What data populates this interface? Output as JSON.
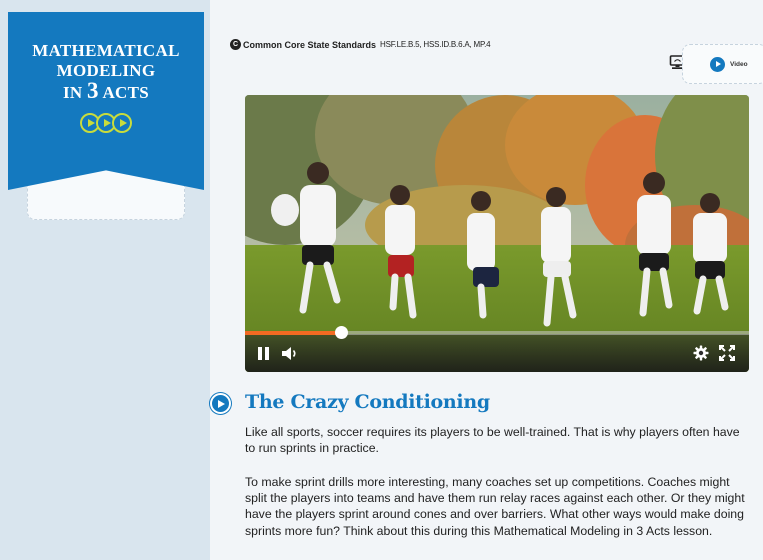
{
  "banner": {
    "line1": "MATHEMATICAL",
    "line2": "MODELING",
    "line3_prefix": "IN ",
    "line3_num": "3",
    "line3_suffix": " ACTS",
    "icon_count": 3,
    "accent_color": "#c8dc3c",
    "brand_color": "#1479bf"
  },
  "standards": {
    "icon_letter": "C",
    "title": "Common Core State Standards",
    "codes": "HSF.LE.B.5, HSS.ID.B.6.A, MP.4"
  },
  "video_link": {
    "label": "Video",
    "screen_icon": "screen-icon",
    "play_icon": "play-circle-icon"
  },
  "player": {
    "progress_fraction": 0.19,
    "progress_color": "#f26a22",
    "controls": [
      "pause-icon",
      "volume-icon",
      "gear-icon",
      "fullscreen-icon"
    ]
  },
  "section": {
    "title": "The Crazy Conditioning",
    "paragraphs": [
      "Like all sports, soccer requires its players to be well-trained. That is why players often have to run sprints in practice.",
      "To make sprint drills more interesting, many coaches set up competitions. Coaches might split the players into teams and have them run relay races against each other. Or they might have the players sprint around cones and over barriers. What other ways would make doing sprints more fun? Think about this during this Mathematical Modeling in 3 Acts lesson."
    ]
  }
}
